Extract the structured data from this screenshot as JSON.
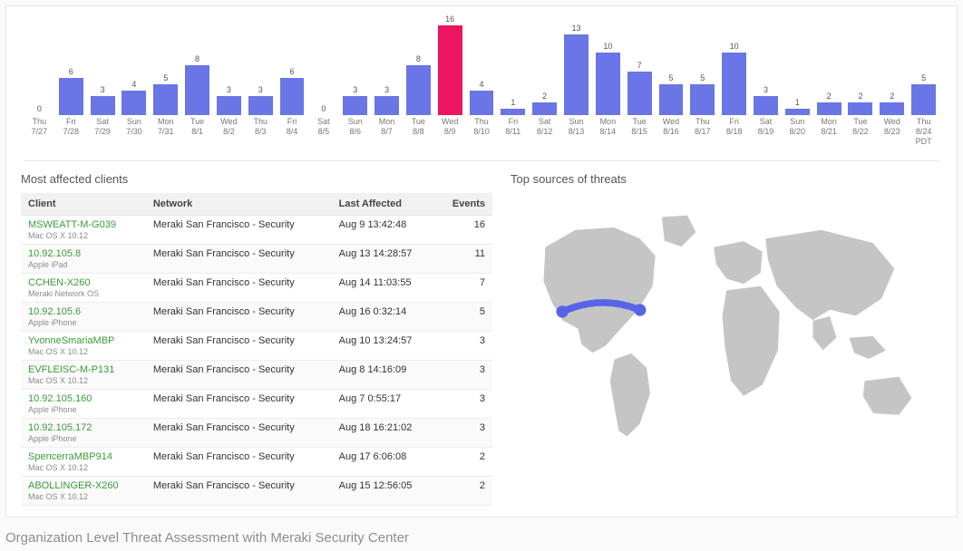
{
  "chart_data": {
    "type": "bar",
    "title": "",
    "xlabel": "",
    "ylabel": "",
    "ylim": [
      0,
      16
    ],
    "highlight_index": 13,
    "tz_suffix": "PDT",
    "points": [
      {
        "label_top": "Thu",
        "label_bot": "7/27",
        "v": 0
      },
      {
        "label_top": "Fri",
        "label_bot": "7/28",
        "v": 6
      },
      {
        "label_top": "Sat",
        "label_bot": "7/29",
        "v": 3
      },
      {
        "label_top": "Sun",
        "label_bot": "7/30",
        "v": 4
      },
      {
        "label_top": "Mon",
        "label_bot": "7/31",
        "v": 5
      },
      {
        "label_top": "Tue",
        "label_bot": "8/1",
        "v": 8
      },
      {
        "label_top": "Wed",
        "label_bot": "8/2",
        "v": 3
      },
      {
        "label_top": "Thu",
        "label_bot": "8/3",
        "v": 3
      },
      {
        "label_top": "Fri",
        "label_bot": "8/4",
        "v": 6
      },
      {
        "label_top": "Sat",
        "label_bot": "8/5",
        "v": 0
      },
      {
        "label_top": "Sun",
        "label_bot": "8/6",
        "v": 3
      },
      {
        "label_top": "Mon",
        "label_bot": "8/7",
        "v": 3
      },
      {
        "label_top": "Tue",
        "label_bot": "8/8",
        "v": 8
      },
      {
        "label_top": "Wed",
        "label_bot": "8/9",
        "v": 16
      },
      {
        "label_top": "Thu",
        "label_bot": "8/10",
        "v": 4
      },
      {
        "label_top": "Fri",
        "label_bot": "8/11",
        "v": 1
      },
      {
        "label_top": "Sat",
        "label_bot": "8/12",
        "v": 2
      },
      {
        "label_top": "Sun",
        "label_bot": "8/13",
        "v": 13
      },
      {
        "label_top": "Mon",
        "label_bot": "8/14",
        "v": 10
      },
      {
        "label_top": "Tue",
        "label_bot": "8/15",
        "v": 7
      },
      {
        "label_top": "Wed",
        "label_bot": "8/16",
        "v": 5
      },
      {
        "label_top": "Thu",
        "label_bot": "8/17",
        "v": 5
      },
      {
        "label_top": "Fri",
        "label_bot": "8/18",
        "v": 10
      },
      {
        "label_top": "Sat",
        "label_bot": "8/19",
        "v": 3
      },
      {
        "label_top": "Sun",
        "label_bot": "8/20",
        "v": 1
      },
      {
        "label_top": "Mon",
        "label_bot": "8/21",
        "v": 2
      },
      {
        "label_top": "Tue",
        "label_bot": "8/22",
        "v": 2
      },
      {
        "label_top": "Wed",
        "label_bot": "8/23",
        "v": 2
      },
      {
        "label_top": "Thu",
        "label_bot": "8/24",
        "v": 5
      }
    ]
  },
  "clients": {
    "title": "Most affected clients",
    "headers": {
      "client": "Client",
      "network": "Network",
      "last": "Last Affected",
      "events": "Events"
    },
    "rows": [
      {
        "name": "MSWEATT-M-G039",
        "sub": "Mac OS X 10.12",
        "network": "Meraki San Francisco - Security",
        "last": "Aug 9 13:42:48",
        "events": 16
      },
      {
        "name": "10.92.105.8",
        "sub": "Apple iPad",
        "network": "Meraki San Francisco - Security",
        "last": "Aug 13 14:28:57",
        "events": 11
      },
      {
        "name": "CCHEN-X260",
        "sub": "Meraki Network OS",
        "network": "Meraki San Francisco - Security",
        "last": "Aug 14 11:03:55",
        "events": 7
      },
      {
        "name": "10.92.105.6",
        "sub": "Apple iPhone",
        "network": "Meraki San Francisco - Security",
        "last": "Aug 16 0:32:14",
        "events": 5
      },
      {
        "name": "YvonneSmariaMBP",
        "sub": "Mac OS X 10.12",
        "network": "Meraki San Francisco - Security",
        "last": "Aug 10 13:24:57",
        "events": 3
      },
      {
        "name": "EVFLEISC-M-P131",
        "sub": "Mac OS X 10.12",
        "network": "Meraki San Francisco - Security",
        "last": "Aug 8 14:16:09",
        "events": 3
      },
      {
        "name": "10.92.105.160",
        "sub": "Apple iPhone",
        "network": "Meraki San Francisco - Security",
        "last": "Aug 7 0:55:17",
        "events": 3
      },
      {
        "name": "10.92.105.172",
        "sub": "Apple iPhone",
        "network": "Meraki San Francisco - Security",
        "last": "Aug 18 16:21:02",
        "events": 3
      },
      {
        "name": "SpencerraMBP914",
        "sub": "Mac OS X 10.12",
        "network": "Meraki San Francisco - Security",
        "last": "Aug 17 6:06:08",
        "events": 2
      },
      {
        "name": "ABOLLINGER-X260",
        "sub": "Mac OS X 10.12",
        "network": "Meraki San Francisco - Security",
        "last": "Aug 15 12:56:05",
        "events": 2
      }
    ]
  },
  "map": {
    "title": "Top sources of threats"
  },
  "caption": "Organization Level Threat Assessment with Meraki Security Center"
}
